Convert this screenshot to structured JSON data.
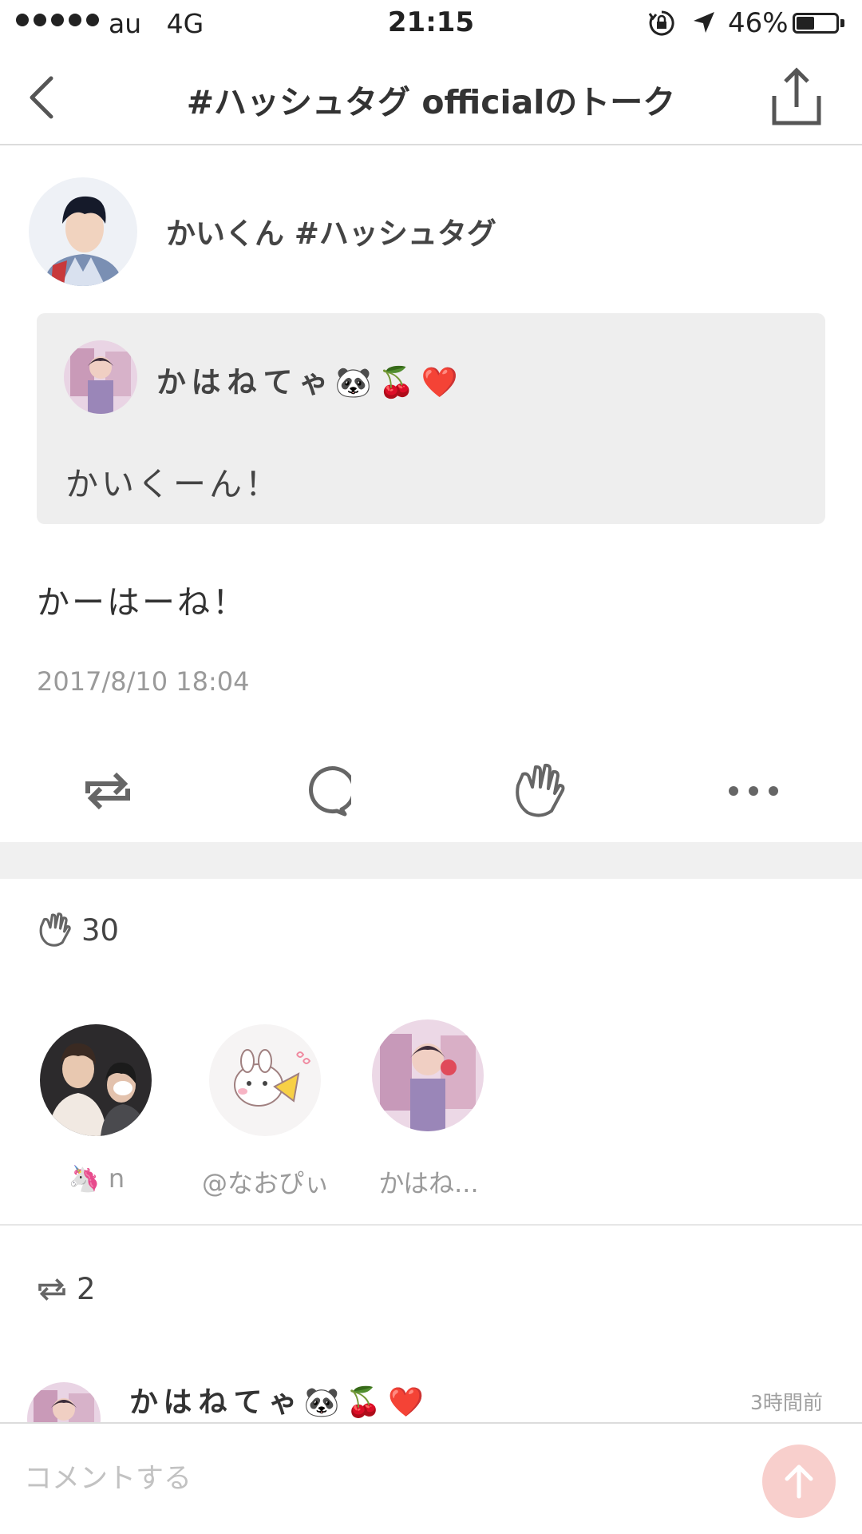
{
  "status_bar": {
    "carrier": "au",
    "network": "4G",
    "time": "21:15",
    "battery_percent": "46%",
    "battery_level": 0.46
  },
  "nav": {
    "title": "#ハッシュタグ officialのトーク",
    "back_icon": "chevron-left-icon",
    "share_icon": "share-icon"
  },
  "post": {
    "author_name": "かいくん #ハッシュタグ",
    "quote": {
      "author_name": "かはねてゃ🐼🍒❤️",
      "text": "かいくーん！"
    },
    "text": "かーはーね！",
    "timestamp": "2017/8/10 18:04",
    "actions": [
      "retweet-icon",
      "comment-icon",
      "clap-icon",
      "more-icon"
    ]
  },
  "likes": {
    "count": "30",
    "users": [
      {
        "name": "🦄 n"
      },
      {
        "name": "@なおぴぃ"
      },
      {
        "name": "かはね..."
      }
    ]
  },
  "reposts": {
    "count": "2",
    "items": [
      {
        "name": "かはねてゃ🐼🍒❤️",
        "time": "3時間前"
      }
    ]
  },
  "comment_bar": {
    "placeholder": "コメントする",
    "accent": "#f8cfcc"
  }
}
